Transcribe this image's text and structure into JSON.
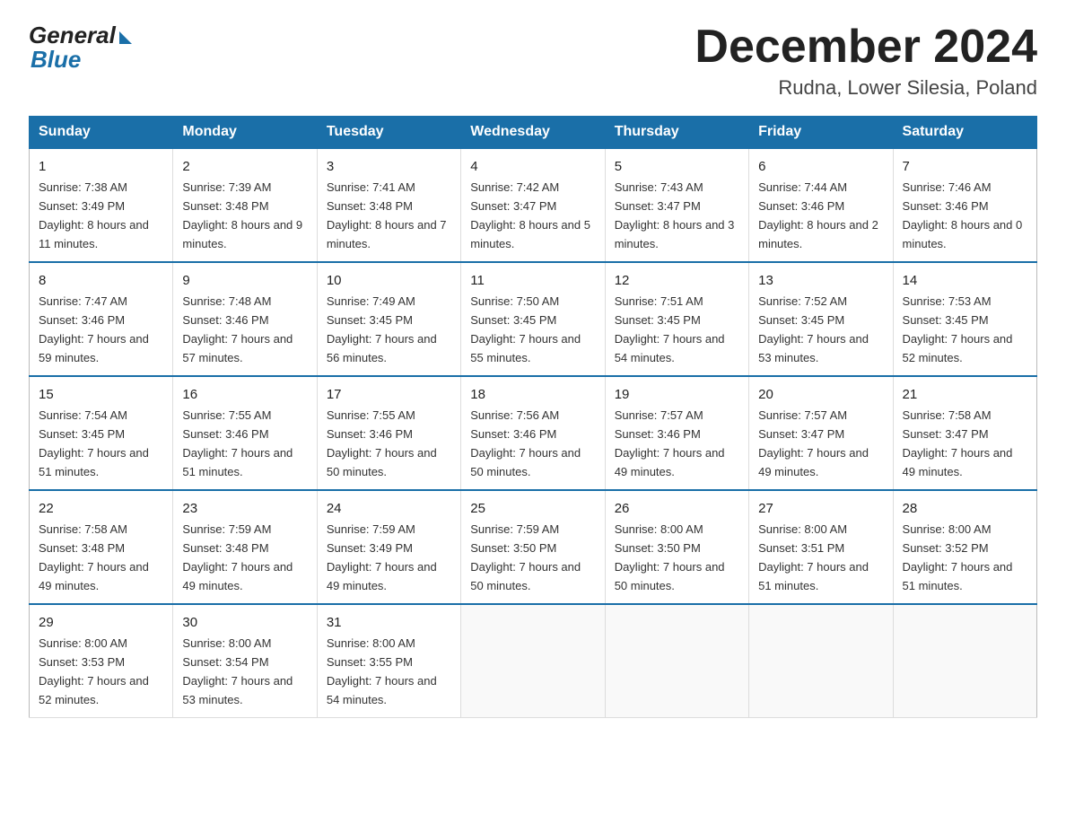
{
  "logo": {
    "general": "General",
    "blue": "Blue"
  },
  "title": {
    "month_year": "December 2024",
    "location": "Rudna, Lower Silesia, Poland"
  },
  "weekdays": [
    "Sunday",
    "Monday",
    "Tuesday",
    "Wednesday",
    "Thursday",
    "Friday",
    "Saturday"
  ],
  "weeks": [
    [
      {
        "day": "1",
        "sunrise": "7:38 AM",
        "sunset": "3:49 PM",
        "daylight": "8 hours and 11 minutes."
      },
      {
        "day": "2",
        "sunrise": "7:39 AM",
        "sunset": "3:48 PM",
        "daylight": "8 hours and 9 minutes."
      },
      {
        "day": "3",
        "sunrise": "7:41 AM",
        "sunset": "3:48 PM",
        "daylight": "8 hours and 7 minutes."
      },
      {
        "day": "4",
        "sunrise": "7:42 AM",
        "sunset": "3:47 PM",
        "daylight": "8 hours and 5 minutes."
      },
      {
        "day": "5",
        "sunrise": "7:43 AM",
        "sunset": "3:47 PM",
        "daylight": "8 hours and 3 minutes."
      },
      {
        "day": "6",
        "sunrise": "7:44 AM",
        "sunset": "3:46 PM",
        "daylight": "8 hours and 2 minutes."
      },
      {
        "day": "7",
        "sunrise": "7:46 AM",
        "sunset": "3:46 PM",
        "daylight": "8 hours and 0 minutes."
      }
    ],
    [
      {
        "day": "8",
        "sunrise": "7:47 AM",
        "sunset": "3:46 PM",
        "daylight": "7 hours and 59 minutes."
      },
      {
        "day": "9",
        "sunrise": "7:48 AM",
        "sunset": "3:46 PM",
        "daylight": "7 hours and 57 minutes."
      },
      {
        "day": "10",
        "sunrise": "7:49 AM",
        "sunset": "3:45 PM",
        "daylight": "7 hours and 56 minutes."
      },
      {
        "day": "11",
        "sunrise": "7:50 AM",
        "sunset": "3:45 PM",
        "daylight": "7 hours and 55 minutes."
      },
      {
        "day": "12",
        "sunrise": "7:51 AM",
        "sunset": "3:45 PM",
        "daylight": "7 hours and 54 minutes."
      },
      {
        "day": "13",
        "sunrise": "7:52 AM",
        "sunset": "3:45 PM",
        "daylight": "7 hours and 53 minutes."
      },
      {
        "day": "14",
        "sunrise": "7:53 AM",
        "sunset": "3:45 PM",
        "daylight": "7 hours and 52 minutes."
      }
    ],
    [
      {
        "day": "15",
        "sunrise": "7:54 AM",
        "sunset": "3:45 PM",
        "daylight": "7 hours and 51 minutes."
      },
      {
        "day": "16",
        "sunrise": "7:55 AM",
        "sunset": "3:46 PM",
        "daylight": "7 hours and 51 minutes."
      },
      {
        "day": "17",
        "sunrise": "7:55 AM",
        "sunset": "3:46 PM",
        "daylight": "7 hours and 50 minutes."
      },
      {
        "day": "18",
        "sunrise": "7:56 AM",
        "sunset": "3:46 PM",
        "daylight": "7 hours and 50 minutes."
      },
      {
        "day": "19",
        "sunrise": "7:57 AM",
        "sunset": "3:46 PM",
        "daylight": "7 hours and 49 minutes."
      },
      {
        "day": "20",
        "sunrise": "7:57 AM",
        "sunset": "3:47 PM",
        "daylight": "7 hours and 49 minutes."
      },
      {
        "day": "21",
        "sunrise": "7:58 AM",
        "sunset": "3:47 PM",
        "daylight": "7 hours and 49 minutes."
      }
    ],
    [
      {
        "day": "22",
        "sunrise": "7:58 AM",
        "sunset": "3:48 PM",
        "daylight": "7 hours and 49 minutes."
      },
      {
        "day": "23",
        "sunrise": "7:59 AM",
        "sunset": "3:48 PM",
        "daylight": "7 hours and 49 minutes."
      },
      {
        "day": "24",
        "sunrise": "7:59 AM",
        "sunset": "3:49 PM",
        "daylight": "7 hours and 49 minutes."
      },
      {
        "day": "25",
        "sunrise": "7:59 AM",
        "sunset": "3:50 PM",
        "daylight": "7 hours and 50 minutes."
      },
      {
        "day": "26",
        "sunrise": "8:00 AM",
        "sunset": "3:50 PM",
        "daylight": "7 hours and 50 minutes."
      },
      {
        "day": "27",
        "sunrise": "8:00 AM",
        "sunset": "3:51 PM",
        "daylight": "7 hours and 51 minutes."
      },
      {
        "day": "28",
        "sunrise": "8:00 AM",
        "sunset": "3:52 PM",
        "daylight": "7 hours and 51 minutes."
      }
    ],
    [
      {
        "day": "29",
        "sunrise": "8:00 AM",
        "sunset": "3:53 PM",
        "daylight": "7 hours and 52 minutes."
      },
      {
        "day": "30",
        "sunrise": "8:00 AM",
        "sunset": "3:54 PM",
        "daylight": "7 hours and 53 minutes."
      },
      {
        "day": "31",
        "sunrise": "8:00 AM",
        "sunset": "3:55 PM",
        "daylight": "7 hours and 54 minutes."
      },
      null,
      null,
      null,
      null
    ]
  ]
}
